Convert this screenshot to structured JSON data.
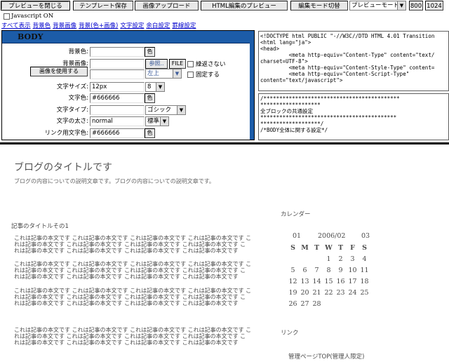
{
  "toolbar": {
    "close_preview": "プレビューを閉じる",
    "save_template": "テンプレート保存",
    "upload_image": "画像アップロード",
    "html_preview": "HTML編集のプレビュー",
    "edit_mode": "編集モード切替",
    "preview_mode": "プレビューモード",
    "w800": "800",
    "w1024": "1024",
    "javascript_label": "Javascript ON"
  },
  "links": [
    "すべて表示",
    "背景色",
    "背景画像",
    "背景(色+画像)",
    "文字設定",
    "余白設定",
    "罫線設定"
  ],
  "panel": {
    "title": "BODY",
    "bg_color_label": "背景色:",
    "bg_image_label": "背景画像:",
    "use_image_btn": "画像を使用する",
    "color_btn": "色",
    "browse_btn": "参照..",
    "file_btn": "FILE",
    "no_repeat_label": "繰返さない",
    "position_value": "左上",
    "fixed_label": "固定する",
    "font_size_label": "文字サイズ:",
    "font_size_value": "12px",
    "font_size_select": "8",
    "text_color_label": "文字色:",
    "text_color_value": "#666666",
    "font_type_label": "文字タイプ:",
    "font_type_value": "ゴシック",
    "font_weight_label": "文字の太さ:",
    "font_weight_value": "normal",
    "font_weight_select": "標準",
    "link_color_label": "リンク用文字色:",
    "link_color_value": "#666666"
  },
  "source_top": "<!DOCTYPE html PUBLIC \"-//W3C//DTD HTML 4.01 Transition\n<html lang=\"ja\">\n<head>\n         <meta http-equiv=\"Content-Type\" content=\"text/\ncharset=UTF-8\">\n         <meta http-equiv=\"Content-Style-Type\" content=\n         <meta http-equiv=\"Content-Script-Type\"\ncontent=\"text/javascript\">",
  "source_bottom": "/*******************************************\n*******************\n全ブロックの共通設定\n*******************************************\n*******************/\n/*BODY全体に関する設定*/",
  "blog": {
    "title": "ブログのタイトルです",
    "description": "ブログの内容についての説明文章です。ブログの内容についての説明文章です。",
    "article_title": "記事のタイトルその1",
    "para_lines": [
      "これは記事の本文です  これは記事の本文です  これは記事の本文です  これは記事の本文です  こ",
      "れは記事の本文です  これは記事の本文です  これは記事の本文です  これは記事の本文です  こ",
      "れは記事の本文です  これは記事の本文です  これは記事の本文です  これは記事の本文です"
    ],
    "calendar_heading": "カレンダー",
    "calendar": {
      "prev": "01",
      "month": "2006/02",
      "next": "03",
      "weekdays": [
        "S",
        "M",
        "T",
        "W",
        "T",
        "F",
        "S"
      ],
      "weeks": [
        [
          "",
          "",
          "",
          "1",
          "2",
          "3",
          "4"
        ],
        [
          "5",
          "6",
          "7",
          "8",
          "9",
          "10",
          "11"
        ],
        [
          "12",
          "13",
          "14",
          "15",
          "16",
          "17",
          "18"
        ],
        [
          "19",
          "20",
          "21",
          "22",
          "23",
          "24",
          "25"
        ],
        [
          "26",
          "27",
          "28",
          "",
          "",
          "",
          ""
        ]
      ]
    },
    "link_heading": "リンク",
    "admin_link": "管理ページTOP(管理人限定)"
  }
}
